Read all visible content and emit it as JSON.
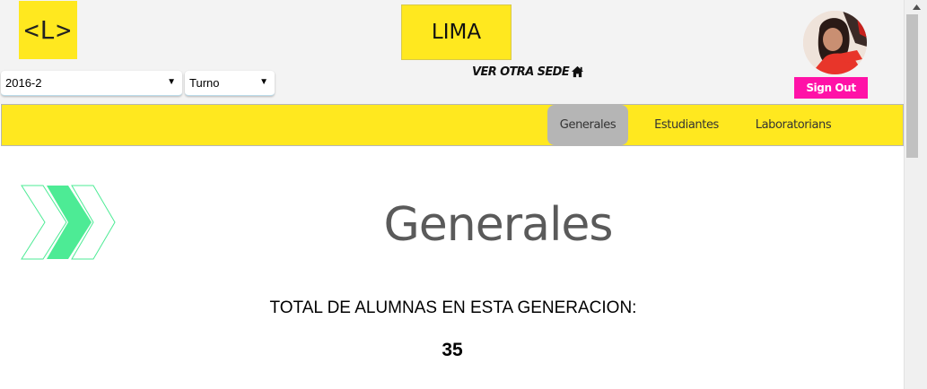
{
  "header": {
    "logo_text": "<L>",
    "venue_name": "LIMA",
    "other_venue_label": "VER OTRA SEDE",
    "other_venue_icon": "home-icon",
    "signout_label": "Sign Out",
    "avatar_icon": "user-avatar"
  },
  "filters": {
    "semester": {
      "value": "2016-2",
      "icon": "dropdown-arrow-icon"
    },
    "shift": {
      "value": "Turno",
      "icon": "dropdown-arrow-icon"
    }
  },
  "nav": {
    "tabs": [
      {
        "label": "Generales",
        "active": true
      },
      {
        "label": "Estudiantes",
        "active": false
      },
      {
        "label": "Laboratorians",
        "active": false
      }
    ]
  },
  "main": {
    "title": "Generales",
    "decoration_icon": "chevrons-right-icon",
    "total_label": "TOTAL DE ALUMNAS EN ESTA GENERACION:",
    "total_value": "35"
  },
  "colors": {
    "brand_yellow": "#ffe81f",
    "signout_pink": "#ff12a7",
    "active_tab_gray": "#b5b5b5",
    "chevron_green": "#4deb95",
    "header_bg": "#f3f3f3"
  }
}
